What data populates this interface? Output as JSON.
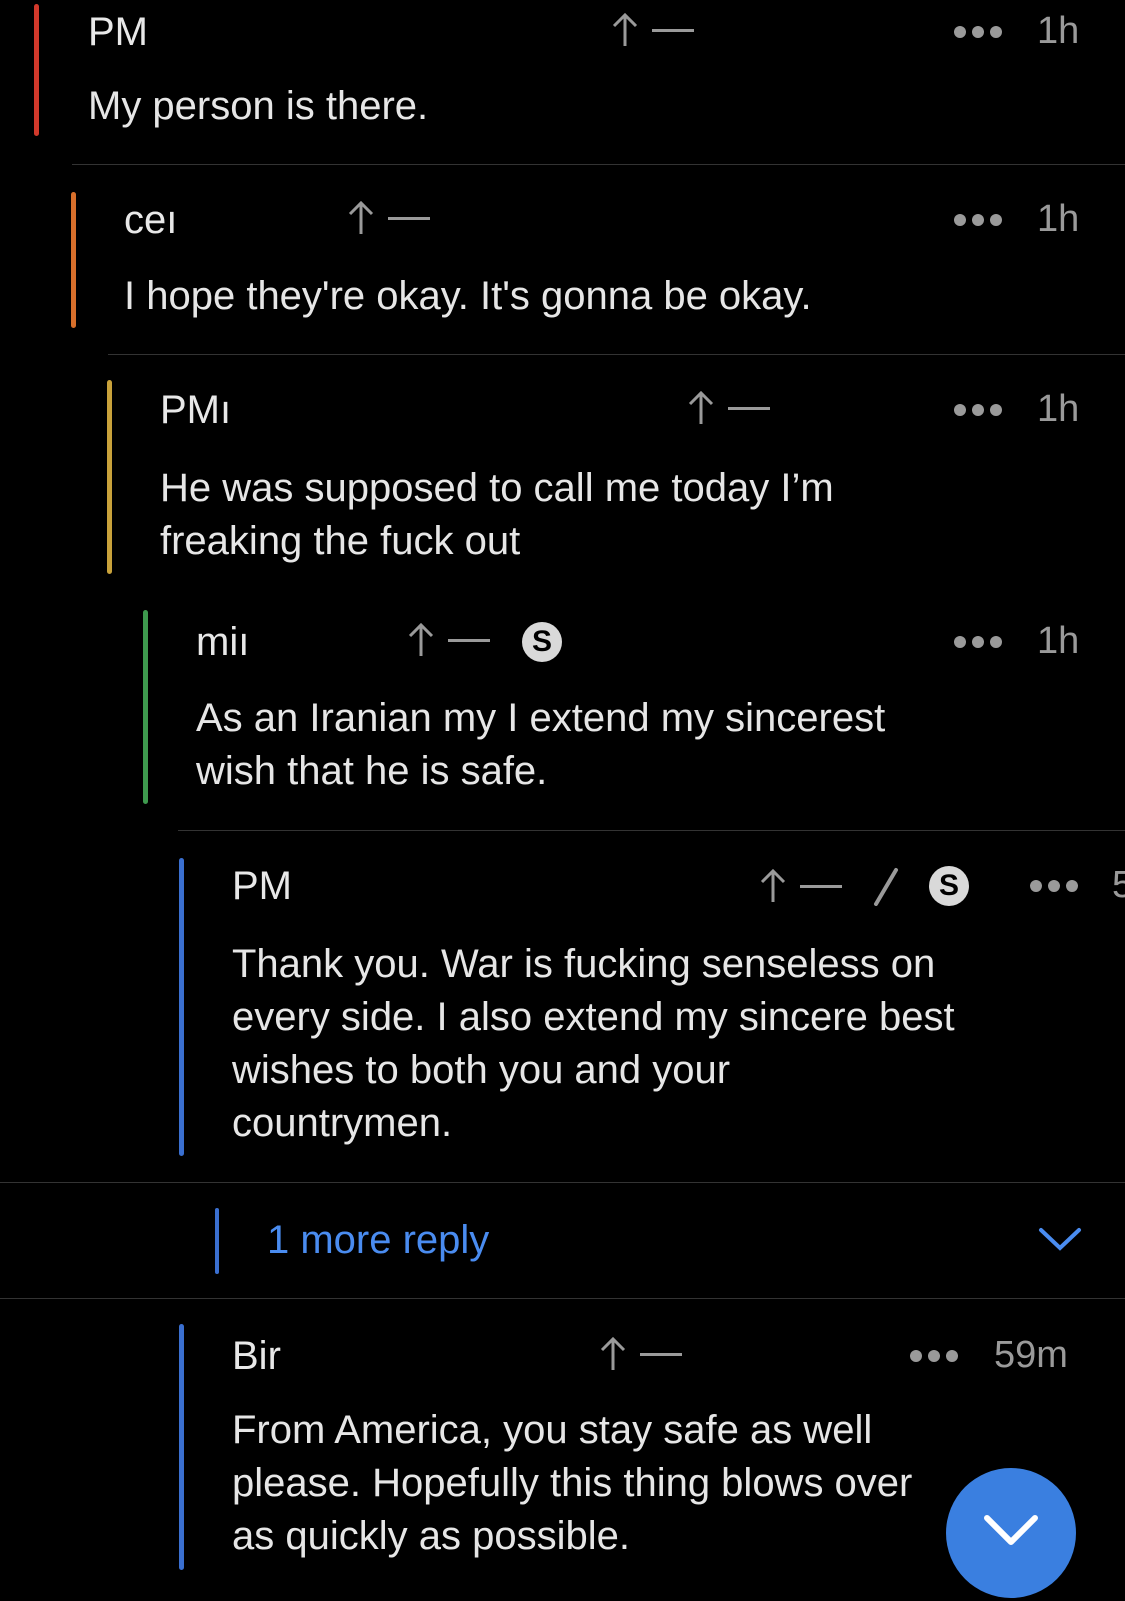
{
  "colors": {
    "depth1": "#d1392b",
    "depth2": "#d86f2b",
    "depth3": "#c9a23b",
    "depth4": "#3e9a4e",
    "depth5": "#3a6fd0",
    "accent": "#4a8cf0"
  },
  "comments": [
    {
      "author": "PM",
      "time": "1h",
      "body": "My person is there."
    },
    {
      "author": "ceı",
      "time": "1h",
      "body": "I hope they're okay. It's gonna be okay."
    },
    {
      "author": "PMı",
      "time": "1h",
      "body_lines": [
        "He was supposed to call me today I’m",
        "freaking the fuck out"
      ]
    },
    {
      "author": "miı",
      "time": "1h",
      "badge": "S",
      "body_lines": [
        "As an Iranian my I extend my sincerest",
        "wish that he is safe."
      ]
    },
    {
      "author": "PM",
      "time": "5",
      "badge": "S",
      "body_lines": [
        "Thank you. War is fucking senseless on",
        "every side. I also extend my sincere best",
        "wishes to both you and your",
        "countrymen."
      ]
    },
    {
      "author": "Bir",
      "time": "59m",
      "body_lines": [
        "From America, you stay safe as well",
        "please. Hopefully this thing blows over",
        "as quickly as possible."
      ]
    }
  ],
  "more_reply": {
    "label": "1 more reply"
  },
  "icons": {
    "upvote": "up-arrow-icon",
    "more": "ellipsis-icon",
    "edit": "pencil-icon",
    "badge": "s-badge-icon",
    "expand": "chevron-down-icon",
    "fab": "chevron-down-icon"
  }
}
